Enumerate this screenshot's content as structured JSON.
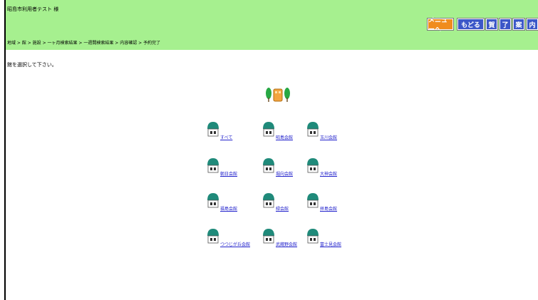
{
  "header": {
    "user_greeting": "昭島市利用者テスト 様",
    "breadcrumb": "地域 > 館 > 施設 > 一ヶ月検索結果 > 一週間検索結果 > 内容確認 > 予約完了",
    "buttons": {
      "menu": "メニューへ",
      "back": "もどる",
      "glyph_1": "賀",
      "glyph_2": "了",
      "glyph_3": "案",
      "glyph_4": "内"
    }
  },
  "main": {
    "instruction": "館を選択して下さい。",
    "venues": [
      {
        "label": "すべて"
      },
      {
        "label": "昭島会館"
      },
      {
        "label": "玉川会館"
      },
      {
        "label": "朝日会館"
      },
      {
        "label": "堀向会館"
      },
      {
        "label": "大神会館"
      },
      {
        "label": "福島会館"
      },
      {
        "label": "緑会館"
      },
      {
        "label": "拝島会館"
      },
      {
        "label": "つつじが丘会館"
      },
      {
        "label": "武蔵野会館"
      },
      {
        "label": "富士見会館"
      }
    ]
  },
  "colors": {
    "header_bg": "#a6f08f",
    "menu_button": "#f08c1e",
    "nav_button": "#3c57c8",
    "link": "#2222cc",
    "house_roof": "#1f8a7a"
  },
  "icons": {
    "header_decoration": "trees-with-building-icon",
    "venue": "house-icon"
  }
}
